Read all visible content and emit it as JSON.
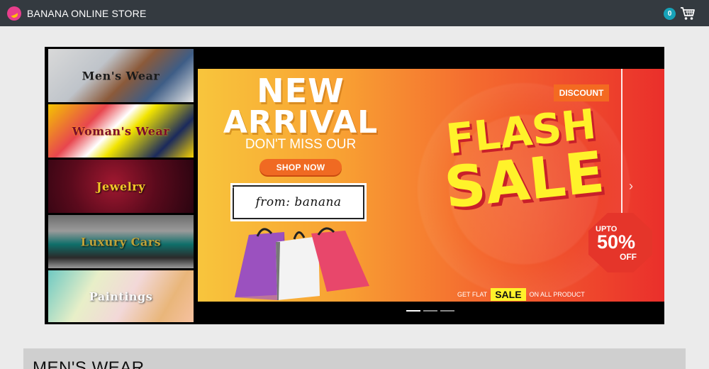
{
  "navbar": {
    "brand": "BANANA ONLINE STORE",
    "cart_count": "0",
    "logo_icon": "banana-logo-icon",
    "cart_icon": "shopping-cart-icon"
  },
  "categories": [
    {
      "label": "Men's Wear"
    },
    {
      "label": "Woman's Wear"
    },
    {
      "label": "Jewelry"
    },
    {
      "label": "Luxury Cars"
    },
    {
      "label": "Paintings"
    }
  ],
  "banner": {
    "line1": "NEW",
    "line2": "ARRIVAL",
    "tagline": "DON'T MISS OUR",
    "shop_now": "SHOP NOW",
    "from_text": "from: banana",
    "discount": "DISCOUNT",
    "flash": "FLASH",
    "sale": "SALE",
    "upto": "UPTO",
    "percent": "50%",
    "off": "OFF",
    "flat_prefix": "GET FLAT",
    "flat_sale": "SALE",
    "flat_suffix": "ON ALL PRODUCT"
  },
  "carousel": {
    "indicator_count": 3,
    "active_index": 0
  },
  "section": {
    "title": "MEN'S WEAR"
  },
  "colors": {
    "navbar_bg": "#343a40",
    "cart_badge": "#17a2b8",
    "brand_logo": "#e83e8c",
    "page_bg": "#ebebeb",
    "sale_yellow": "#fff22a",
    "shop_now_orange": "#f06a22"
  }
}
